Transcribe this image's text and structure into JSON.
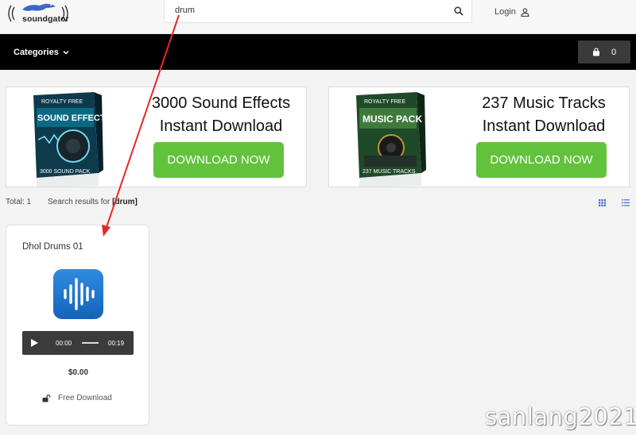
{
  "header": {
    "logo_text": "soundgator",
    "search_value": "drum",
    "login_label": "Login"
  },
  "nav": {
    "categories_label": "Categories",
    "cart_count": "0"
  },
  "banners": [
    {
      "box_top": "ROYALTY FREE",
      "box_title": "SOUND EFFECTS",
      "box_bottom": "3000 SOUND PACK",
      "line1": "3000 Sound Effects",
      "line2": "Instant Download",
      "button": "DOWNLOAD NOW"
    },
    {
      "box_top": "ROYALTY FREE",
      "box_title": "MUSIC PACK",
      "box_bottom": "237 MUSIC TRACKS",
      "line1": "237 Music Tracks",
      "line2": "Instant Download",
      "button": "DOWNLOAD NOW"
    }
  ],
  "results": {
    "total_label": "Total: 1",
    "search_prefix": "Search results for ",
    "search_term": "[drum]"
  },
  "product": {
    "title": "Dhol Drums 01",
    "current_time": "00:00",
    "duration": "00:19",
    "price": "$0.00",
    "download_label": "Free Download"
  },
  "colors": {
    "accent_green": "#62c23c",
    "navbar": "#000000",
    "annotation_arrow": "#e8262a",
    "view_icon_blue": "#3b6fd0"
  },
  "watermark": "sanlang2021"
}
